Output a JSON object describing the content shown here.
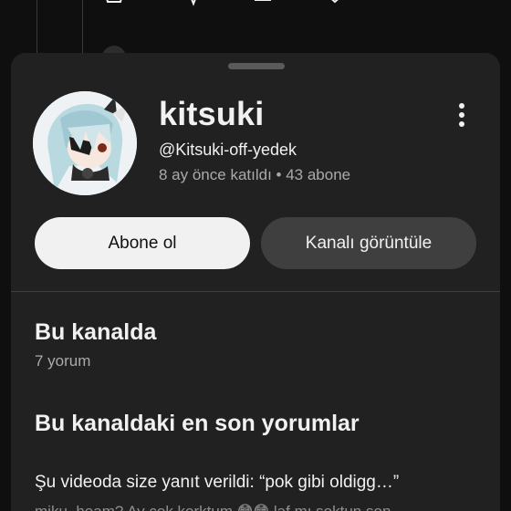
{
  "channel": {
    "name": "kitsuki",
    "handle": "@Kitsuki-off-yedek",
    "meta": "8 ay önce katıldı • 43 abone"
  },
  "actions": {
    "subscribe_label": "Abone ol",
    "view_channel_label": "Kanalı görüntüle"
  },
  "section_on_channel": {
    "title": "Bu kanalda",
    "count": "7 yorum"
  },
  "section_recent": {
    "title": "Bu kanaldaki en son yorumlar",
    "reply_line": "Şu videoda size yanıt verildi: “pok gibi oldigg…”",
    "preview_line": "miku_heam? Ay çok korktum 😳😳 laf mı soktun son"
  },
  "icons": [
    "more-vert-icon",
    "avatar-image",
    "drag-handle"
  ]
}
